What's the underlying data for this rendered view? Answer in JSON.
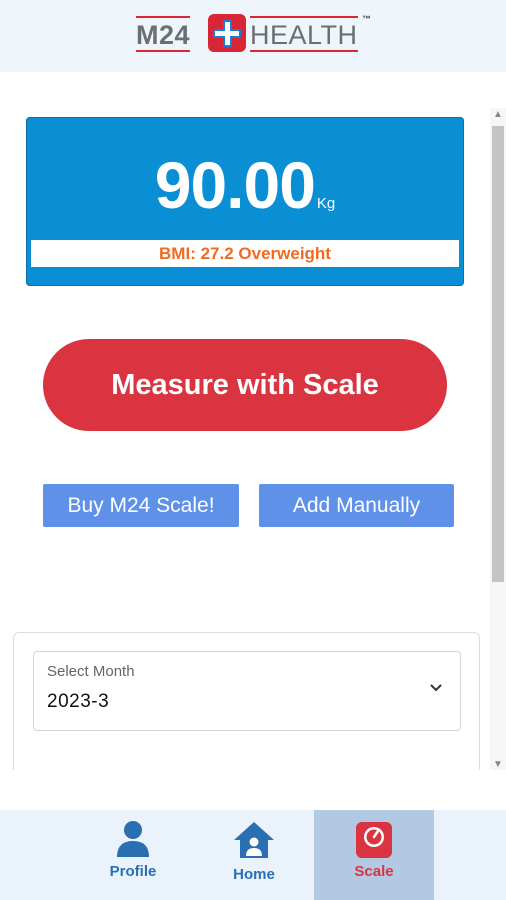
{
  "header": {
    "logo": {
      "left": "M24",
      "right": "HEALTH",
      "tm": "™"
    }
  },
  "weight": {
    "value": "90.00",
    "unit": "Kg",
    "bmi_text": "BMI:  27.2 Overweight"
  },
  "actions": {
    "measure_label": "Measure with Scale",
    "buy_label": "Buy M24 Scale!",
    "add_label": "Add Manually"
  },
  "month_select": {
    "label": "Select Month",
    "value": "2023-3"
  },
  "nav": {
    "items": [
      {
        "label": "Profile",
        "icon": "person-icon",
        "active": false
      },
      {
        "label": "Home",
        "icon": "home-icon",
        "active": false
      },
      {
        "label": "Scale",
        "icon": "scale-icon",
        "active": true
      }
    ]
  },
  "colors": {
    "primary_blue": "#0a8ed4",
    "accent_red": "#d93440",
    "bmi_orange": "#f26a21",
    "secondary_button": "#5f91e8",
    "nav_bg": "#eaf3fb",
    "nav_active_bg": "#b3c8e2"
  }
}
